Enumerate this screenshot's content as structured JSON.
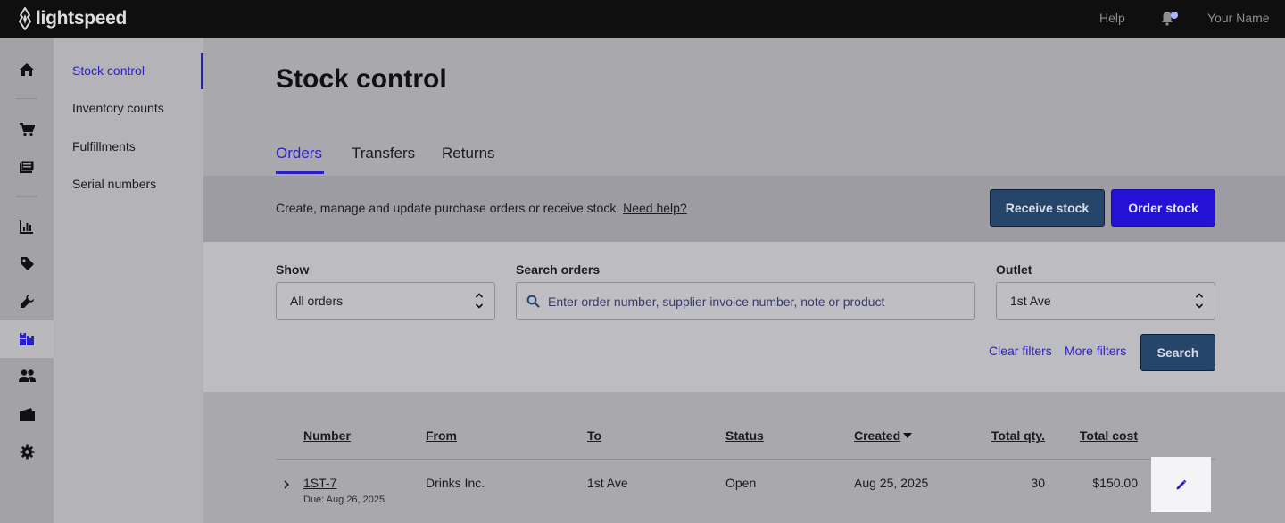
{
  "brand": {
    "name": "lightspeed"
  },
  "topbar": {
    "help": "Help",
    "user": "Your Name"
  },
  "rail": {
    "items": [
      "home-icon",
      "cart-icon",
      "register-icon",
      "reports-icon",
      "tag-icon",
      "wrench-icon",
      "boxes-icon",
      "users-icon",
      "wallet-icon",
      "gear-icon"
    ],
    "active": "boxes-icon"
  },
  "subnav": {
    "items": [
      "Stock control",
      "Inventory counts",
      "Fulfillments",
      "Serial numbers"
    ],
    "active": "Stock control"
  },
  "page": {
    "title": "Stock control"
  },
  "tabs": [
    "Orders",
    "Transfers",
    "Returns"
  ],
  "info": {
    "text": "Create, manage and update purchase orders or receive stock.",
    "help_link": "Need help?",
    "receive_button": "Receive stock",
    "order_button": "Order stock"
  },
  "filters": {
    "show_label": "Show",
    "show_value": "All orders",
    "search_label": "Search orders",
    "search_placeholder": "Enter order number, supplier invoice number, note or product",
    "outlet_label": "Outlet",
    "outlet_value": "1st Ave",
    "clear": "Clear filters",
    "more": "More filters",
    "search_button": "Search"
  },
  "table": {
    "columns": [
      "Number",
      "From",
      "To",
      "Status",
      "Created",
      "Total qty.",
      "Total cost"
    ],
    "sorted_column": "Created",
    "rows": [
      {
        "number": "1ST-7",
        "due": "Due: Aug 26, 2025",
        "from": "Drinks Inc.",
        "to": "1st Ave",
        "status": "Open",
        "created": "Aug 25, 2025",
        "qty": "30",
        "cost": "$150.00"
      }
    ]
  },
  "colors": {
    "accent": "#2a1fc4",
    "primary_dark": "#26456b",
    "topbar": "#0f0f10"
  }
}
